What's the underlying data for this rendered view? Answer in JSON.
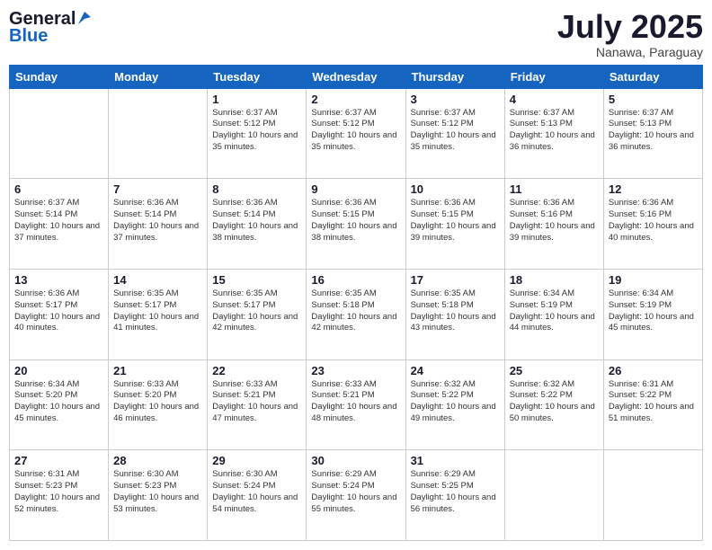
{
  "header": {
    "logo_general": "General",
    "logo_blue": "Blue",
    "month": "July 2025",
    "location": "Nanawa, Paraguay"
  },
  "weekdays": [
    "Sunday",
    "Monday",
    "Tuesday",
    "Wednesday",
    "Thursday",
    "Friday",
    "Saturday"
  ],
  "weeks": [
    [
      {
        "day": "",
        "sunrise": "",
        "sunset": "",
        "daylight": ""
      },
      {
        "day": "",
        "sunrise": "",
        "sunset": "",
        "daylight": ""
      },
      {
        "day": "1",
        "sunrise": "Sunrise: 6:37 AM",
        "sunset": "Sunset: 5:12 PM",
        "daylight": "Daylight: 10 hours and 35 minutes."
      },
      {
        "day": "2",
        "sunrise": "Sunrise: 6:37 AM",
        "sunset": "Sunset: 5:12 PM",
        "daylight": "Daylight: 10 hours and 35 minutes."
      },
      {
        "day": "3",
        "sunrise": "Sunrise: 6:37 AM",
        "sunset": "Sunset: 5:12 PM",
        "daylight": "Daylight: 10 hours and 35 minutes."
      },
      {
        "day": "4",
        "sunrise": "Sunrise: 6:37 AM",
        "sunset": "Sunset: 5:13 PM",
        "daylight": "Daylight: 10 hours and 36 minutes."
      },
      {
        "day": "5",
        "sunrise": "Sunrise: 6:37 AM",
        "sunset": "Sunset: 5:13 PM",
        "daylight": "Daylight: 10 hours and 36 minutes."
      }
    ],
    [
      {
        "day": "6",
        "sunrise": "Sunrise: 6:37 AM",
        "sunset": "Sunset: 5:14 PM",
        "daylight": "Daylight: 10 hours and 37 minutes."
      },
      {
        "day": "7",
        "sunrise": "Sunrise: 6:36 AM",
        "sunset": "Sunset: 5:14 PM",
        "daylight": "Daylight: 10 hours and 37 minutes."
      },
      {
        "day": "8",
        "sunrise": "Sunrise: 6:36 AM",
        "sunset": "Sunset: 5:14 PM",
        "daylight": "Daylight: 10 hours and 38 minutes."
      },
      {
        "day": "9",
        "sunrise": "Sunrise: 6:36 AM",
        "sunset": "Sunset: 5:15 PM",
        "daylight": "Daylight: 10 hours and 38 minutes."
      },
      {
        "day": "10",
        "sunrise": "Sunrise: 6:36 AM",
        "sunset": "Sunset: 5:15 PM",
        "daylight": "Daylight: 10 hours and 39 minutes."
      },
      {
        "day": "11",
        "sunrise": "Sunrise: 6:36 AM",
        "sunset": "Sunset: 5:16 PM",
        "daylight": "Daylight: 10 hours and 39 minutes."
      },
      {
        "day": "12",
        "sunrise": "Sunrise: 6:36 AM",
        "sunset": "Sunset: 5:16 PM",
        "daylight": "Daylight: 10 hours and 40 minutes."
      }
    ],
    [
      {
        "day": "13",
        "sunrise": "Sunrise: 6:36 AM",
        "sunset": "Sunset: 5:17 PM",
        "daylight": "Daylight: 10 hours and 40 minutes."
      },
      {
        "day": "14",
        "sunrise": "Sunrise: 6:35 AM",
        "sunset": "Sunset: 5:17 PM",
        "daylight": "Daylight: 10 hours and 41 minutes."
      },
      {
        "day": "15",
        "sunrise": "Sunrise: 6:35 AM",
        "sunset": "Sunset: 5:17 PM",
        "daylight": "Daylight: 10 hours and 42 minutes."
      },
      {
        "day": "16",
        "sunrise": "Sunrise: 6:35 AM",
        "sunset": "Sunset: 5:18 PM",
        "daylight": "Daylight: 10 hours and 42 minutes."
      },
      {
        "day": "17",
        "sunrise": "Sunrise: 6:35 AM",
        "sunset": "Sunset: 5:18 PM",
        "daylight": "Daylight: 10 hours and 43 minutes."
      },
      {
        "day": "18",
        "sunrise": "Sunrise: 6:34 AM",
        "sunset": "Sunset: 5:19 PM",
        "daylight": "Daylight: 10 hours and 44 minutes."
      },
      {
        "day": "19",
        "sunrise": "Sunrise: 6:34 AM",
        "sunset": "Sunset: 5:19 PM",
        "daylight": "Daylight: 10 hours and 45 minutes."
      }
    ],
    [
      {
        "day": "20",
        "sunrise": "Sunrise: 6:34 AM",
        "sunset": "Sunset: 5:20 PM",
        "daylight": "Daylight: 10 hours and 45 minutes."
      },
      {
        "day": "21",
        "sunrise": "Sunrise: 6:33 AM",
        "sunset": "Sunset: 5:20 PM",
        "daylight": "Daylight: 10 hours and 46 minutes."
      },
      {
        "day": "22",
        "sunrise": "Sunrise: 6:33 AM",
        "sunset": "Sunset: 5:21 PM",
        "daylight": "Daylight: 10 hours and 47 minutes."
      },
      {
        "day": "23",
        "sunrise": "Sunrise: 6:33 AM",
        "sunset": "Sunset: 5:21 PM",
        "daylight": "Daylight: 10 hours and 48 minutes."
      },
      {
        "day": "24",
        "sunrise": "Sunrise: 6:32 AM",
        "sunset": "Sunset: 5:22 PM",
        "daylight": "Daylight: 10 hours and 49 minutes."
      },
      {
        "day": "25",
        "sunrise": "Sunrise: 6:32 AM",
        "sunset": "Sunset: 5:22 PM",
        "daylight": "Daylight: 10 hours and 50 minutes."
      },
      {
        "day": "26",
        "sunrise": "Sunrise: 6:31 AM",
        "sunset": "Sunset: 5:22 PM",
        "daylight": "Daylight: 10 hours and 51 minutes."
      }
    ],
    [
      {
        "day": "27",
        "sunrise": "Sunrise: 6:31 AM",
        "sunset": "Sunset: 5:23 PM",
        "daylight": "Daylight: 10 hours and 52 minutes."
      },
      {
        "day": "28",
        "sunrise": "Sunrise: 6:30 AM",
        "sunset": "Sunset: 5:23 PM",
        "daylight": "Daylight: 10 hours and 53 minutes."
      },
      {
        "day": "29",
        "sunrise": "Sunrise: 6:30 AM",
        "sunset": "Sunset: 5:24 PM",
        "daylight": "Daylight: 10 hours and 54 minutes."
      },
      {
        "day": "30",
        "sunrise": "Sunrise: 6:29 AM",
        "sunset": "Sunset: 5:24 PM",
        "daylight": "Daylight: 10 hours and 55 minutes."
      },
      {
        "day": "31",
        "sunrise": "Sunrise: 6:29 AM",
        "sunset": "Sunset: 5:25 PM",
        "daylight": "Daylight: 10 hours and 56 minutes."
      },
      {
        "day": "",
        "sunrise": "",
        "sunset": "",
        "daylight": ""
      },
      {
        "day": "",
        "sunrise": "",
        "sunset": "",
        "daylight": ""
      }
    ]
  ]
}
